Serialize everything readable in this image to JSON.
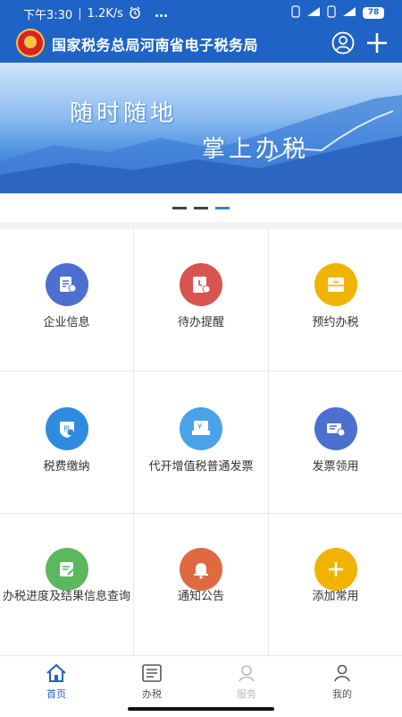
{
  "status_bar": {
    "time": "下午3:30",
    "speed": "1.2K/s",
    "battery": "78"
  },
  "header": {
    "title": "国家税务总局河南省电子税务局"
  },
  "banner": {
    "line1": "随时随地",
    "line2": "掌上办税"
  },
  "grid": {
    "items": [
      {
        "label": "企业信息",
        "color": "#4d6fd0",
        "icon": "company-info-icon"
      },
      {
        "label": "待办提醒",
        "color": "#d9534f",
        "icon": "clock-reminder-icon"
      },
      {
        "label": "预约办税",
        "color": "#f0b400",
        "icon": "appointment-icon"
      },
      {
        "label": "税费缴纳",
        "color": "#2f8be0",
        "icon": "tax-payment-icon"
      },
      {
        "label": "代开增值税普通发票",
        "color": "#4aa3e8",
        "icon": "invoice-issue-icon"
      },
      {
        "label": "发票领用",
        "color": "#4d6fd0",
        "icon": "invoice-collect-icon"
      },
      {
        "label": "办税进度及结果信息查询",
        "color": "#5cb85c",
        "icon": "progress-query-icon"
      },
      {
        "label": "通知公告",
        "color": "#e06a3f",
        "icon": "bell-icon"
      },
      {
        "label": "添加常用",
        "color": "#f0b400",
        "icon": "plus-icon"
      }
    ]
  },
  "tabbar": {
    "tabs": [
      {
        "label": "首页"
      },
      {
        "label": "办税"
      },
      {
        "label": "服务"
      },
      {
        "label": "我的"
      }
    ]
  },
  "colors": {
    "brand_blue": "#1f63c6",
    "active_indicator": "#2b8ccf"
  }
}
